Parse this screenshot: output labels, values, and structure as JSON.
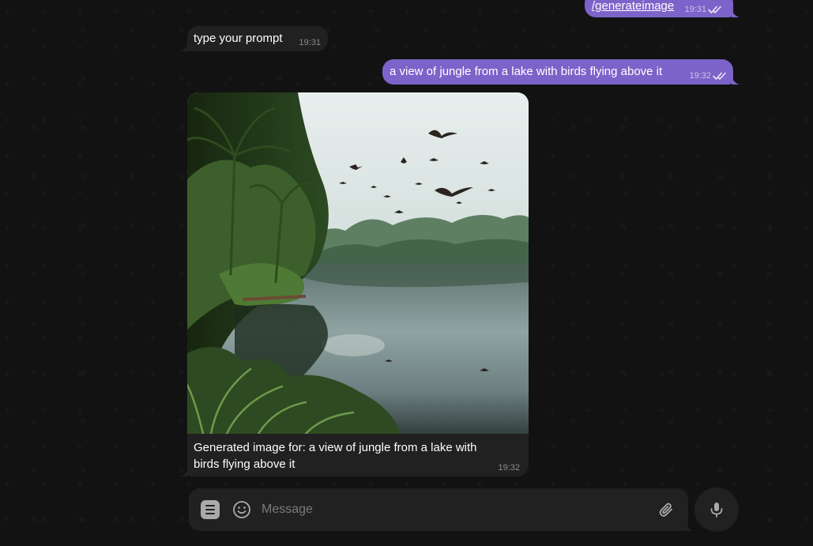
{
  "messages": [
    {
      "id": "m1",
      "direction": "outgoing",
      "text": "/generateimage",
      "time": "19:31",
      "read": true
    },
    {
      "id": "m2",
      "direction": "incoming",
      "text": "type your prompt",
      "time": "19:31"
    },
    {
      "id": "m3",
      "direction": "outgoing",
      "text": "a view of jungle from a lake with birds flying above it",
      "time": "19:32",
      "read": true
    },
    {
      "id": "m4",
      "direction": "incoming",
      "type": "photo",
      "caption": "Generated image for: a view of jungle from a lake with birds flying above it",
      "time": "19:32"
    }
  ],
  "composer": {
    "placeholder": "Message",
    "value": "",
    "icons": {
      "menu": "bot-menu-icon",
      "emoji": "emoji-icon",
      "attach": "paperclip-icon",
      "send": "microphone-icon"
    }
  },
  "colors": {
    "outgoing_bubble": "#7b63c9",
    "incoming_bubble": "#212121",
    "background": "#121213",
    "accent": "#8774e1"
  }
}
